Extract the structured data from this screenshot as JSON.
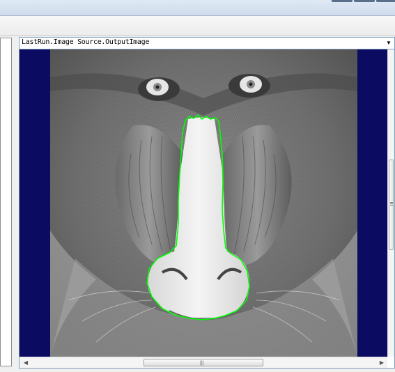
{
  "display": {
    "source_label": "LastRun.Image Source.OutputImage",
    "dropdown_arrow": "▼",
    "scroll_left_arrow": "◀",
    "scroll_right_arrow": "▶",
    "scroll_grip": "|||",
    "background_color": "#0b0b62",
    "contour_color": "#00ff00"
  }
}
